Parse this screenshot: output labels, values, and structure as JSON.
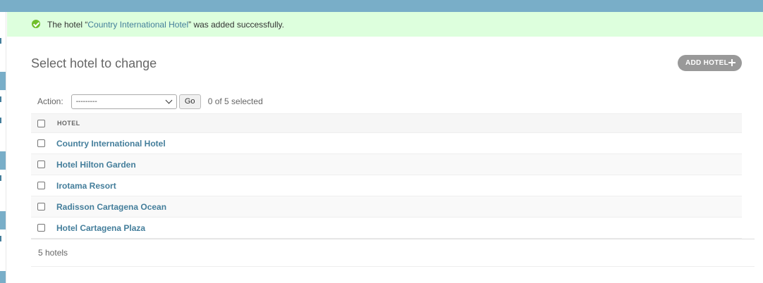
{
  "message": {
    "prefix": "The hotel “",
    "hotel_link": "Country International Hotel",
    "suffix": "” was added successfully.",
    "icon": "check-circle-icon"
  },
  "page": {
    "title": "Select hotel to change",
    "add_button": "ADD HOTEL"
  },
  "actions": {
    "label": "Action:",
    "selected_option": "---------",
    "go_label": "Go",
    "counter": "0 of 5 selected"
  },
  "table": {
    "column_header": "HOTEL",
    "rows": [
      "Country International Hotel",
      "Hotel Hilton Garden",
      "Irotama Resort",
      "Radisson Cartagena Ocean",
      "Hotel Cartagena Plaza"
    ]
  },
  "footer": {
    "count": "5 hotels"
  },
  "colors": {
    "header_bar": "#79aec8",
    "success_bg": "#ddffdd",
    "link": "#447e9b",
    "add_button_bg": "#999999"
  }
}
